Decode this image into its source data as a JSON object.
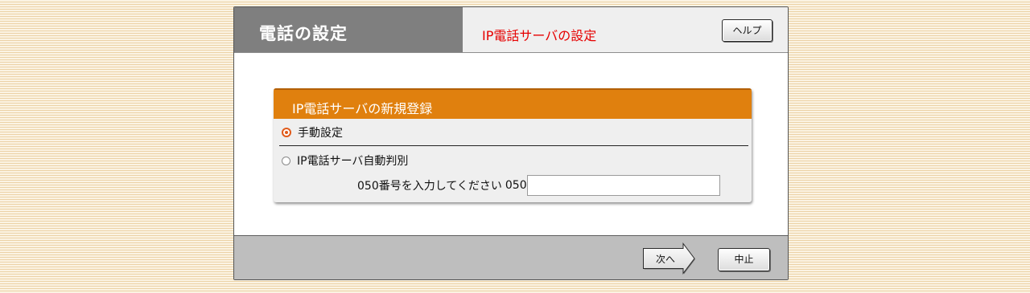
{
  "header": {
    "title": "電話の設定",
    "subtitle": "IP電話サーバの設定",
    "help_label": "ヘルプ"
  },
  "panel": {
    "title": "IP電話サーバの新規登録",
    "options": [
      {
        "label": "手動設定",
        "selected": true
      },
      {
        "label": "IP電話サーバ自動判別",
        "selected": false
      }
    ],
    "number_input": {
      "label": "050番号を入力してください",
      "prefix": "050",
      "value": ""
    }
  },
  "footer": {
    "next_label": "次へ",
    "cancel_label": "中止"
  },
  "colors": {
    "accent_orange": "#e0800e",
    "subtitle_red": "#e60000",
    "radio_selected": "#e05a1a"
  }
}
